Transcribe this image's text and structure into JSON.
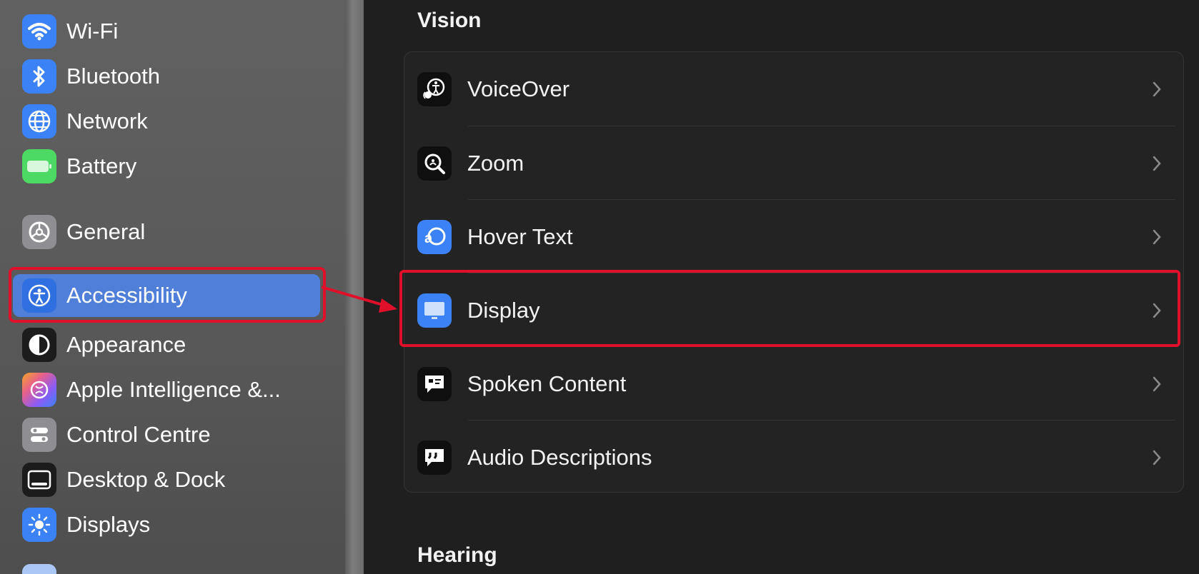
{
  "sidebar": {
    "items": [
      {
        "label": "Wi-Fi",
        "icon": "wifi-icon",
        "color": "#3b82f6"
      },
      {
        "label": "Bluetooth",
        "icon": "bluetooth-icon",
        "color": "#3b82f6"
      },
      {
        "label": "Network",
        "icon": "globe-icon",
        "color": "#3b82f6"
      },
      {
        "label": "Battery",
        "icon": "battery-icon",
        "color": "#4cd964"
      },
      {
        "label": "General",
        "icon": "gear-icon",
        "color": "#8e8e93"
      },
      {
        "label": "Accessibility",
        "icon": "accessibility-icon",
        "color": "#2f6fe0",
        "selected": true
      },
      {
        "label": "Appearance",
        "icon": "appearance-icon",
        "color": "#1c1c1c"
      },
      {
        "label": "Apple Intelligence &...",
        "icon": "apple-intelligence-icon",
        "color": "#e8608c"
      },
      {
        "label": "Control Centre",
        "icon": "control-centre-icon",
        "color": "#8e8e93"
      },
      {
        "label": "Desktop & Dock",
        "icon": "dock-icon",
        "color": "#1c1c1c"
      },
      {
        "label": "Displays",
        "icon": "sun-icon",
        "color": "#3b82f6"
      }
    ]
  },
  "main": {
    "vision_title": "Vision",
    "hearing_title": "Hearing",
    "rows": [
      {
        "label": "VoiceOver",
        "icon": "voiceover-icon"
      },
      {
        "label": "Zoom",
        "icon": "zoom-icon"
      },
      {
        "label": "Hover Text",
        "icon": "hover-text-icon"
      },
      {
        "label": "Display",
        "icon": "display-monitor-icon"
      },
      {
        "label": "Spoken Content",
        "icon": "speech-bubble-icon"
      },
      {
        "label": "Audio Descriptions",
        "icon": "quote-bubble-icon"
      }
    ]
  },
  "colors": {
    "highlight": "#e0102a",
    "selection": "#4f7fd8"
  }
}
